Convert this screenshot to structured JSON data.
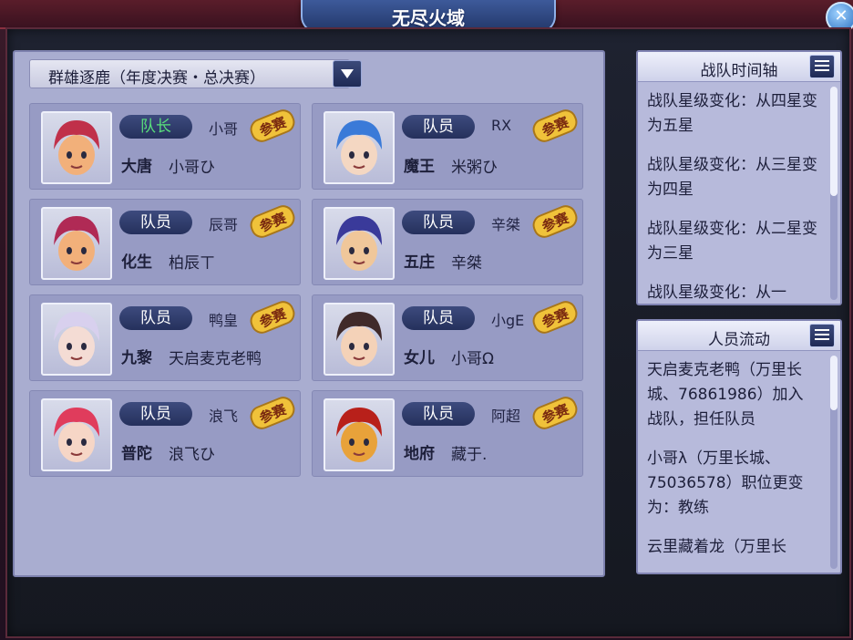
{
  "window": {
    "title": "无尽火域"
  },
  "dropdown": {
    "selected": "群雄逐鹿（年度决赛・总决赛）"
  },
  "members": [
    {
      "role": "队长",
      "nick": "小哥",
      "school": "大唐",
      "name": "小哥ひ",
      "badge": "参赛"
    },
    {
      "role": "队员",
      "nick": "RX",
      "school": "魔王",
      "name": "米粥ひ",
      "badge": "参赛"
    },
    {
      "role": "队员",
      "nick": "辰哥",
      "school": "化生",
      "name": "柏辰ㄒ",
      "badge": "参赛"
    },
    {
      "role": "队员",
      "nick": "辛桀",
      "school": "五庄",
      "name": "辛桀",
      "badge": "参赛"
    },
    {
      "role": "队员",
      "nick": "鸭皇",
      "school": "九黎",
      "name": "天启麦克老鸭",
      "badge": "参赛"
    },
    {
      "role": "队员",
      "nick": "小gE",
      "school": "女儿",
      "name": "小哥Ω",
      "badge": "参赛"
    },
    {
      "role": "队员",
      "nick": "浪飞",
      "school": "普陀",
      "name": "浪飞ひ",
      "badge": "参赛"
    },
    {
      "role": "队员",
      "nick": "阿超",
      "school": "地府",
      "name": "藏于.",
      "badge": "参赛"
    }
  ],
  "timeline": {
    "title": "战队时间轴",
    "entries": [
      "战队星级变化：从四星变为五星",
      "战队星级变化：从三星变为四星",
      "战队星级变化：从二星变为三星",
      "战队星级变化：从一"
    ]
  },
  "movement": {
    "title": "人员流动",
    "entries": [
      "天启麦克老鸭（万里长城、76861986）加入战队，担任队员",
      "小哥λ（万里长城、75036578）职位更变为：教练",
      "云里藏着龙（万里长"
    ]
  },
  "colors": {
    "panel_bg": "#a9add0",
    "card_bg": "#979bc4",
    "role_pill": "#2f3b6b",
    "leader_text": "#59e07b",
    "badge_gold": "#f0c23a"
  }
}
